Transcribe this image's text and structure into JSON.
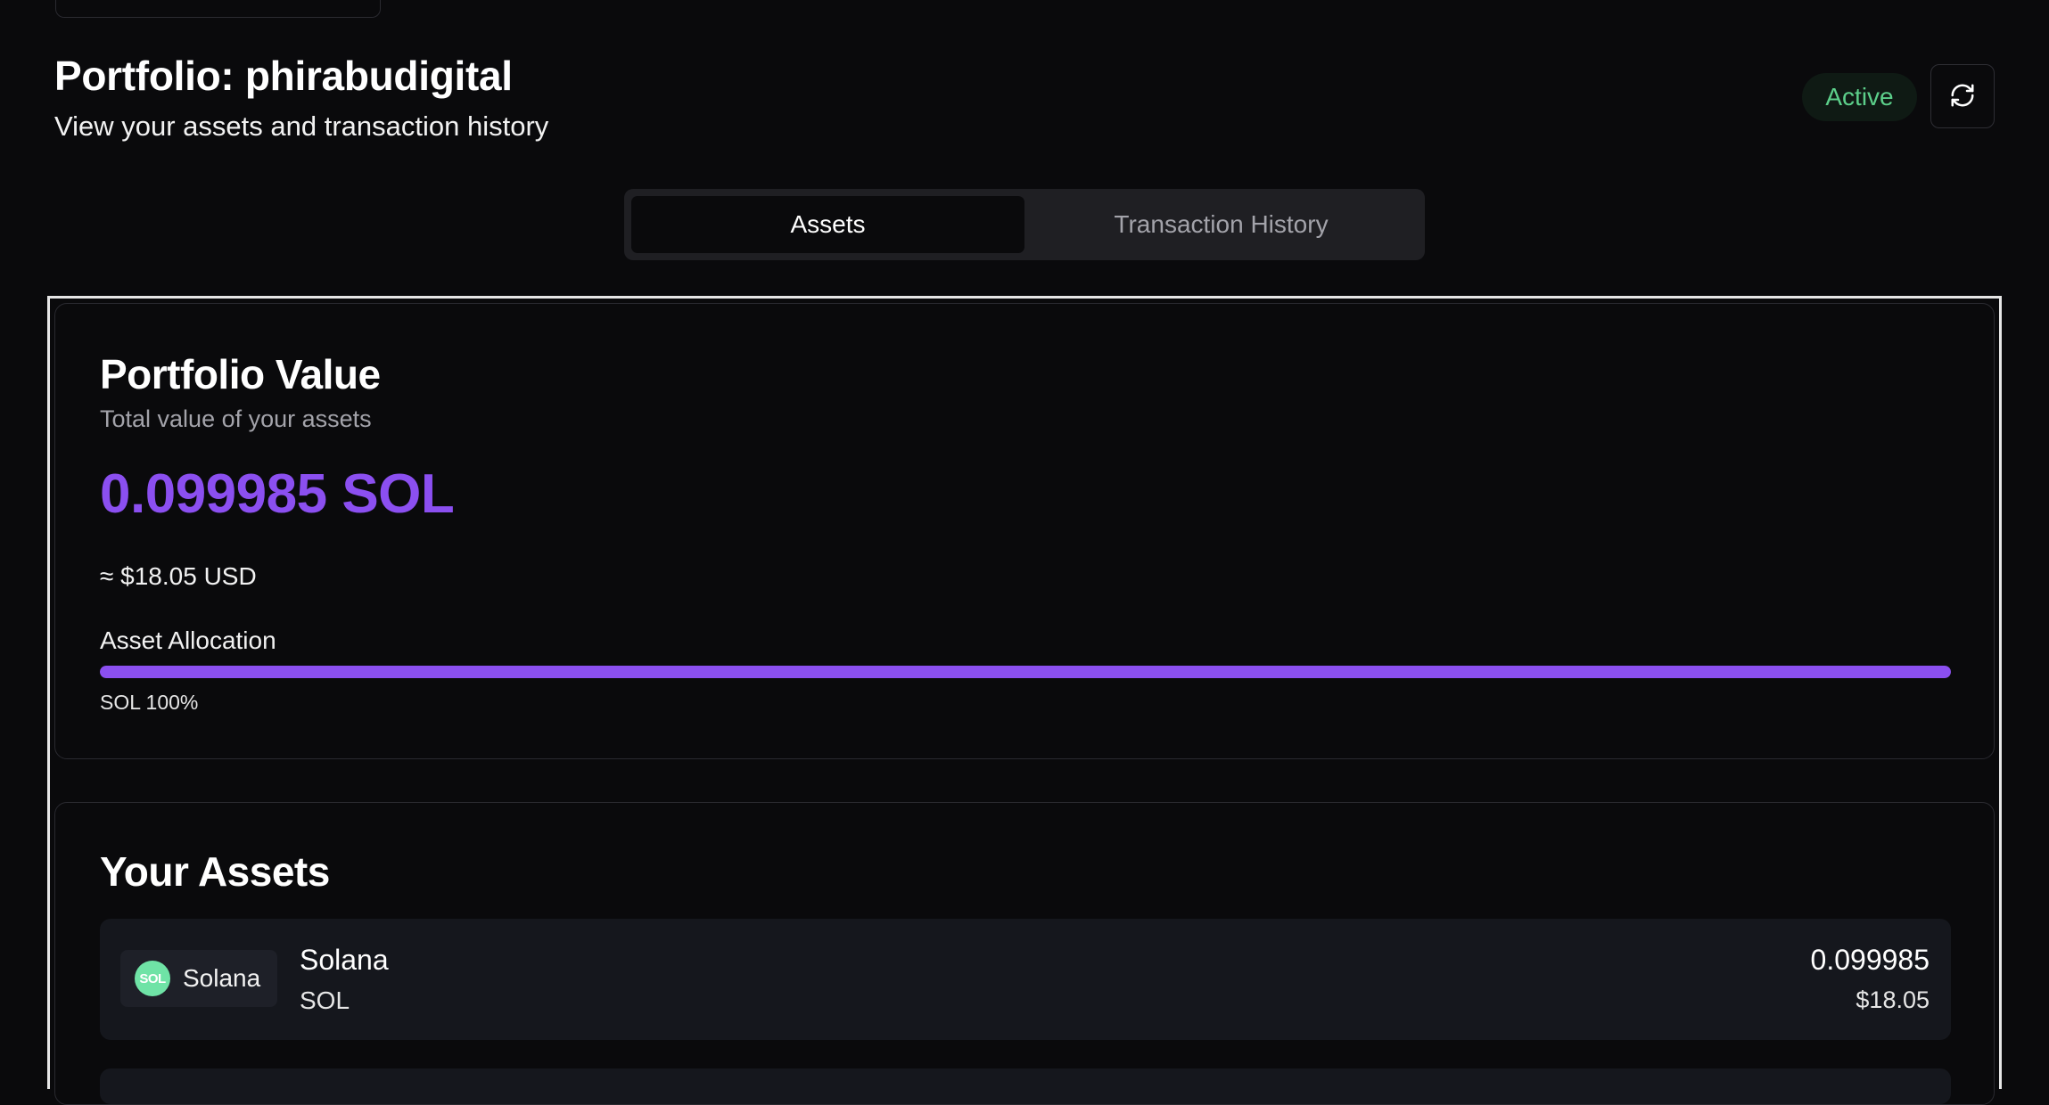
{
  "header": {
    "title": "Portfolio: phirabudigital",
    "subtitle": "View your assets and transaction history",
    "status": "Active",
    "refresh_icon": "refresh-icon"
  },
  "tabs": [
    {
      "label": "Assets",
      "active": true
    },
    {
      "label": "Transaction History",
      "active": false
    }
  ],
  "portfolio_value": {
    "title": "Portfolio Value",
    "description": "Total value of your assets",
    "amount": "0.099985 SOL",
    "usd": "≈ $18.05 USD",
    "allocation_label": "Asset Allocation",
    "allocation": [
      {
        "symbol": "SOL",
        "percent": 100,
        "legend": "SOL 100%",
        "color": "#8b4ff0"
      }
    ]
  },
  "assets": {
    "title": "Your Assets",
    "items": [
      {
        "logo_text": "SOL",
        "chip_label": "Solana",
        "name": "Solana",
        "symbol": "SOL",
        "amount": "0.099985",
        "usd": "$18.05",
        "logo_color": "#6fe3a6"
      }
    ]
  },
  "colors": {
    "accent": "#8b4ff0",
    "status_active": "#5ccf8a",
    "background": "#0a0a0c"
  }
}
